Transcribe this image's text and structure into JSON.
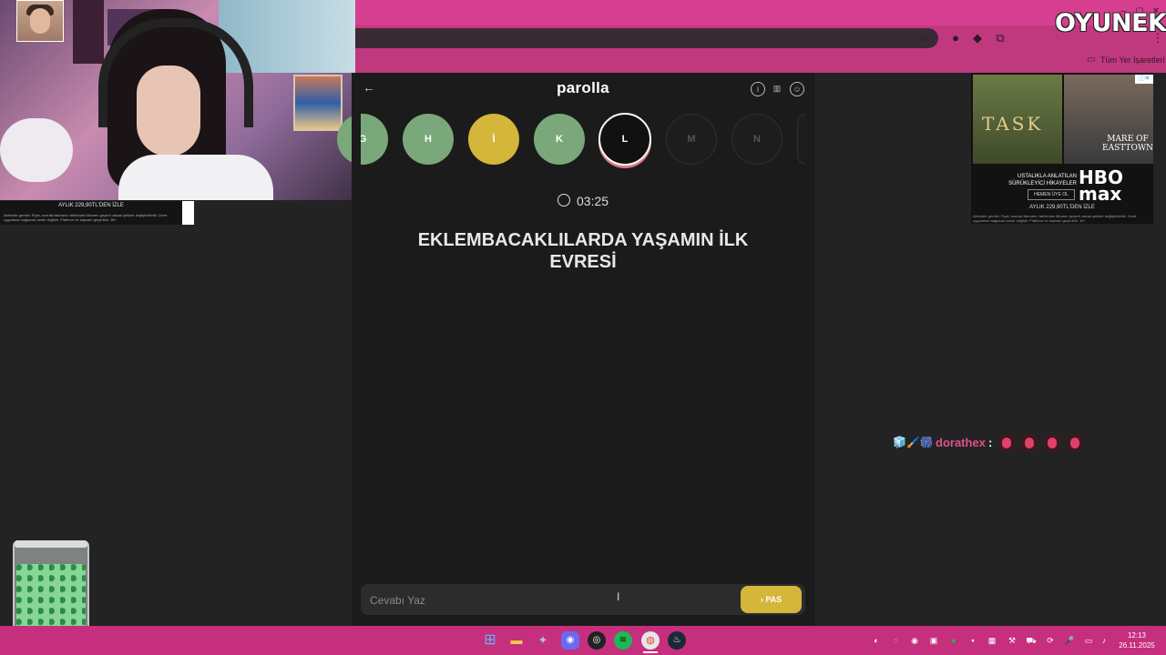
{
  "browser": {
    "bookmarks_label": "Tüm Yer İşaretleri"
  },
  "logo": {
    "text": "OYUNEKS"
  },
  "ad_left": {
    "price_text": "AYLIK 229,90TL'DEN İZLE",
    "fine_print": "Aktivatör gerekir. Fiyat, sonraki faturanın tarihinden itibaren geçerli olacak şekilde değiştirilebilir. Ücret uygulama mağazası kesin değildir. Platform ve kapsam geçerlidir. 18+"
  },
  "app": {
    "title": "parolla",
    "back_icon": "arrow-left-icon",
    "header_icons": [
      "info-icon",
      "stats-icon",
      "profile-icon"
    ],
    "letters": [
      {
        "letter": "G",
        "state": "correct"
      },
      {
        "letter": "H",
        "state": "correct"
      },
      {
        "letter": "İ",
        "state": "passed"
      },
      {
        "letter": "K",
        "state": "correct"
      },
      {
        "letter": "L",
        "state": "current"
      },
      {
        "letter": "M",
        "state": "pending"
      },
      {
        "letter": "N",
        "state": "pending"
      }
    ],
    "timer": "03:25",
    "question": "EKLEMBACAKLILARDA YAŞAMIN İLK EVRESİ",
    "answer_placeholder": "Cevabı Yaz",
    "pass_button": "PAS",
    "colors": {
      "correct": "#7aa87a",
      "passed": "#d4b63a",
      "current_ring": "#e07a84"
    }
  },
  "ad_right": {
    "poster1_title": "TASK",
    "poster2_title": "MARE OF EASTTOWN",
    "tagline": "USTALIKLA ANLATILAN SÜRÜKLEYİCİ HİKAYELER",
    "cta": "HEMEN ÜYE OL",
    "brand": "HBO max",
    "price_text": "AYLIK 229,90TL'DEN İZLE",
    "fine_print": "Aktivatör gerekir. Fiyat, sonraki faturanın tarihinden itibaren geçerli olacak şekilde değiştirilebilir. Ücret uygulama mağazası kesin değildir. Platform ve kapsam geçerlidir. 18+"
  },
  "chat": {
    "username": "dorathex",
    "separator": ":",
    "badges": "🧊🖌️🎆"
  },
  "taskbar": {
    "apps": [
      "windows-start-icon",
      "file-explorer-icon",
      "app-icon",
      "discord-icon",
      "obs-icon",
      "spotify-icon",
      "chrome-icon",
      "steam-icon"
    ],
    "time": "12:13",
    "date": "26.11.2025"
  }
}
